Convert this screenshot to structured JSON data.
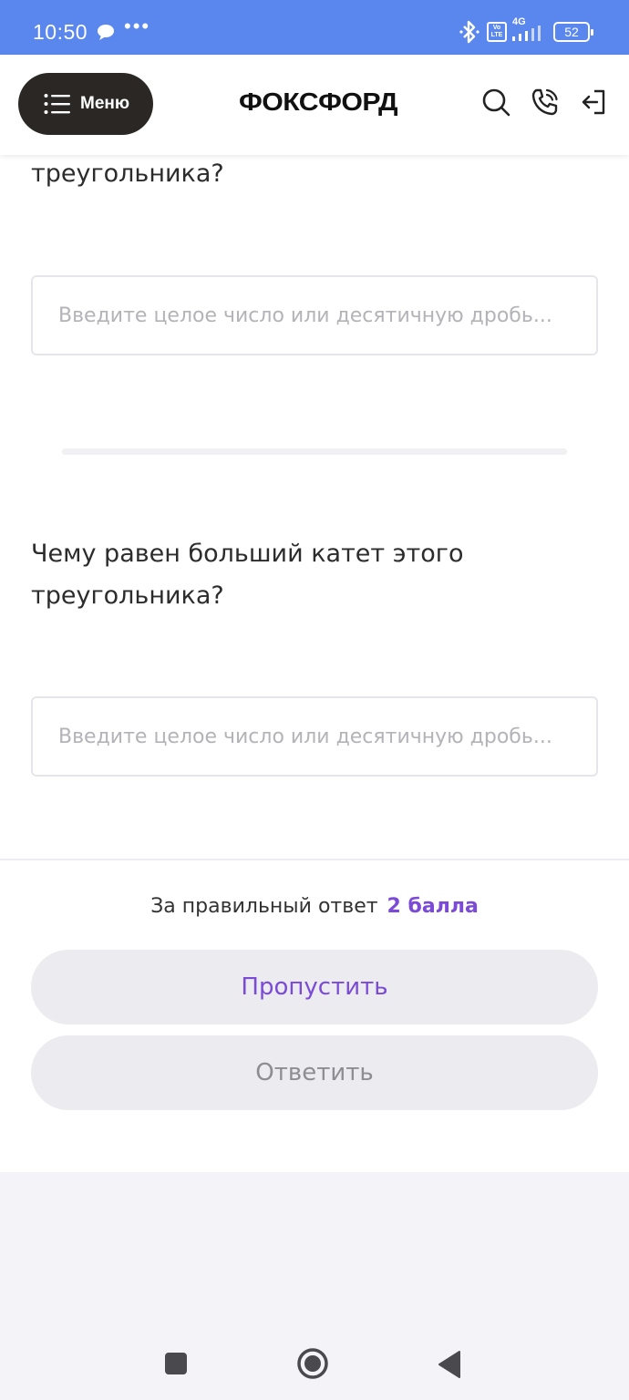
{
  "status_bar": {
    "time": "10:50",
    "dots": "•••",
    "volte": "Vo LTE",
    "network": "4G",
    "battery": "52"
  },
  "header": {
    "menu_label": "Меню",
    "logo": "ФОКСФОРД"
  },
  "questions": [
    {
      "text_tail": "треугольника?",
      "placeholder": "Введите целое число или десятичную дробь..."
    },
    {
      "text_line1": "Чему равен больший катет этого",
      "text_line2": "треугольника?",
      "placeholder": "Введите целое число или десятичную дробь..."
    }
  ],
  "footer": {
    "points_label": "За правильный ответ",
    "points_value": "2 балла",
    "skip_label": "Пропустить",
    "answer_label": "Ответить"
  },
  "colors": {
    "status_bar": "#5a87ee",
    "accent": "#7b4ad6",
    "menu_button": "#2b2724",
    "button_bg": "#ebebf0"
  }
}
